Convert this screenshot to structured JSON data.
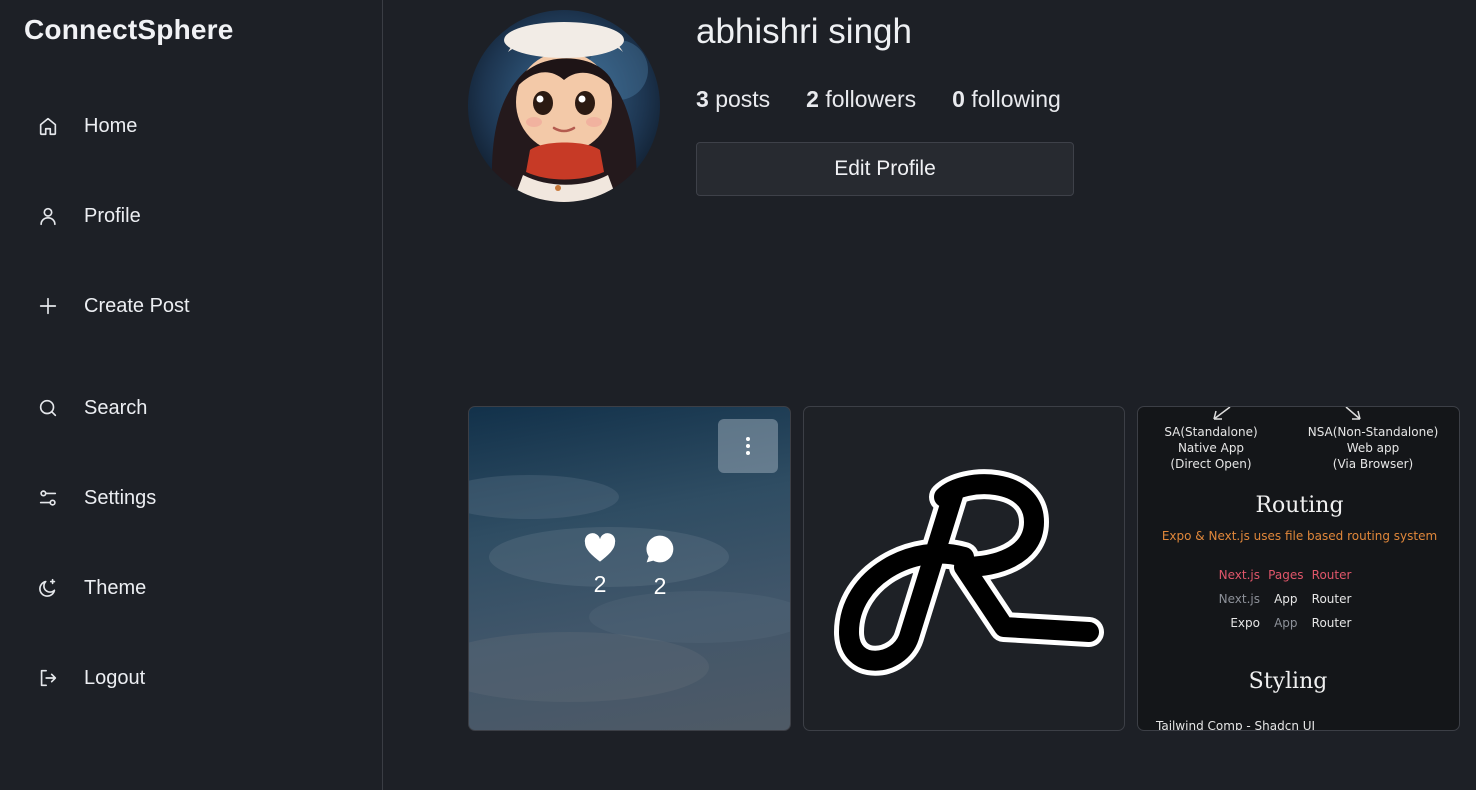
{
  "brand": "ConnectSphere",
  "nav": [
    {
      "label": "Home",
      "icon": "home-icon"
    },
    {
      "label": "Profile",
      "icon": "user-icon"
    },
    {
      "label": "Create Post",
      "icon": "plus-icon"
    },
    {
      "label": "Search",
      "icon": "search-icon"
    },
    {
      "label": "Settings",
      "icon": "sliders-icon"
    },
    {
      "label": "Theme",
      "icon": "moon-icon"
    },
    {
      "label": "Logout",
      "icon": "logout-icon"
    }
  ],
  "profile": {
    "username": "abhishri singh",
    "posts_count": "3",
    "posts_label": "posts",
    "followers_count": "2",
    "followers_label": "followers",
    "following_count": "0",
    "following_label": "following",
    "edit_label": "Edit Profile"
  },
  "posts": [
    {
      "likes": "2",
      "comments": "2"
    },
    {},
    {
      "note": {
        "sa": "SA(Standalone)",
        "sa2": "Native App",
        "sa3": "(Direct Open)",
        "nsa": "NSA(Non-Standalone)",
        "nsa2": "Web app",
        "nsa3": "(Via Browser)",
        "routing": "Routing",
        "routing_sub": "Expo & Next.js uses file based routing system",
        "r1a": "Next.js",
        "r1b": "Pages",
        "r1c": "Router",
        "r2a": "Next.js",
        "r2b": "App",
        "r2c": "Router",
        "r3a": "Expo",
        "r3b": "App",
        "r3c": "Router",
        "styling": "Styling",
        "styling_sub": "Tailwind Comp - Shadcn UI"
      }
    }
  ],
  "colors": {
    "background": "#1d2026",
    "accent_border": "#3c3f46"
  }
}
